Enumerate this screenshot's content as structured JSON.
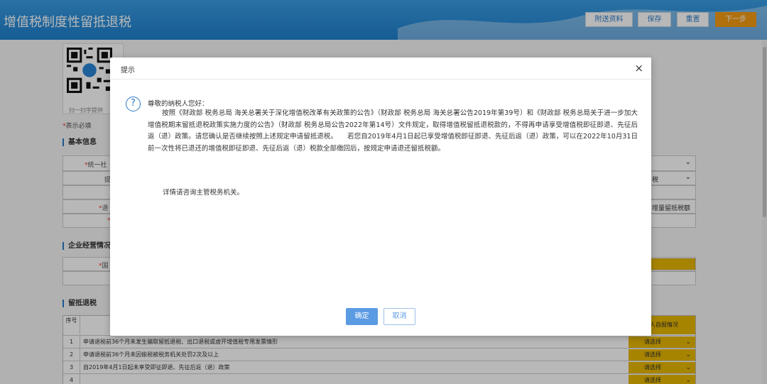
{
  "header": {
    "title": "增值税制度性留抵退税",
    "buttons": {
      "attach": "附送资料",
      "save": "保存",
      "reset": "重置",
      "next": "下一步"
    }
  },
  "qr": {
    "label": "扫一扫字提供"
  },
  "form": {
    "required_note_mark": "*",
    "required_note": "表示必填",
    "section_basic": "基本信息",
    "section_business": "企业经营情况",
    "section_refund": "留抵退税",
    "basic_rows": [
      {
        "label_mark": "*",
        "label": "统一社",
        "value": ""
      },
      {
        "label_mark": "",
        "label": "提",
        "value": "税"
      },
      {
        "label_mark": "",
        "label": "",
        "value": ""
      },
      {
        "label_mark": "*",
        "label": "退",
        "value": "增量留抵税额"
      },
      {
        "label_mark": "*",
        "label": "",
        "value": ""
      }
    ],
    "business_rows": [
      {
        "label_mark": "*",
        "label": "国",
        "value": ""
      }
    ],
    "table": {
      "col_no": "序号",
      "col_status": "人自报情况",
      "rows": [
        {
          "no": "1",
          "text": "申请退税前36个月未发生骗取留抵退税、出口退税或虚开增值税专用发票情形",
          "select": "请选择"
        },
        {
          "no": "2",
          "text": "申请退税前36个月未因偷税被税务机关处罚2次及以上",
          "select": "请选择"
        },
        {
          "no": "3",
          "text": "自2019年4月1日起未享受即征即退、先征后返（退）政策",
          "select": "请选择"
        },
        {
          "no": "4",
          "text": "",
          "select": "请选择"
        }
      ]
    }
  },
  "dialog": {
    "title": "提示",
    "close": "×",
    "greeting": "尊敬的纳税人您好：",
    "body": "按照《财政部 税务总局 海关总署关于深化增值税改革有关政策的公告》（财政部 税务总局 海关总署公告2019年第39号）和《财政部 税务总局关于进一步加大增值税期末留抵退税政策实施力度的公告》（财政部 税务总局公告2022年第14号）文件规定，取得增值税留抵退税款的，不得再申请享受增值税即征即退、先征后返（退）政策。请您确认是否继续按照上述规定申请留抵退税。　　若您自2019年4月1日起已享受增值税即征即退、先征后返（退）政策，可以在2022年10月31日前一次性将已退还的增值税即征即退、先征后返（退）税款全部缴回后，按规定申请退还留抵税额。",
    "tail": "详情请咨询主管税务机关。",
    "ok": "确定",
    "cancel": "取消"
  },
  "colors": {
    "header": "#1e7fce",
    "accent": "#f39c12",
    "select": "#e8b700",
    "primary": "#5b9be3"
  }
}
